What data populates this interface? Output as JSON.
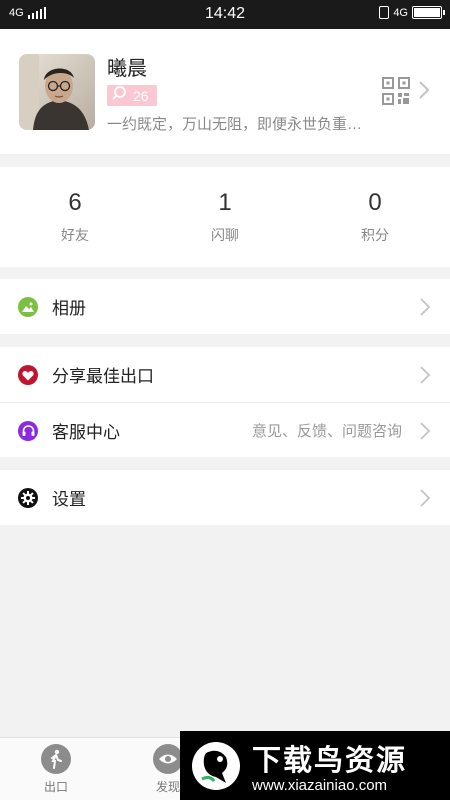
{
  "status_bar": {
    "network_left": "4G",
    "time": "14:42",
    "network_right": "4G",
    "battery_level": 1.0
  },
  "profile": {
    "name": "曦晨",
    "badge_count": "26",
    "signature": "一约既定，万山无阻，即便永世负重…",
    "badge_color": "#f9c8d2"
  },
  "stats": [
    {
      "value": "6",
      "label": "好友"
    },
    {
      "value": "1",
      "label": "闪聊"
    },
    {
      "value": "0",
      "label": "积分"
    }
  ],
  "menu": {
    "album": {
      "label": "相册",
      "icon": "image-icon",
      "color": "#7bc043"
    },
    "share_exit": {
      "label": "分享最佳出口",
      "icon": "heart-icon",
      "color": "#c0152f"
    },
    "support": {
      "label": "客服中心",
      "hint": "意见、反馈、问题咨询",
      "icon": "headset-icon",
      "color": "#8a2be2"
    },
    "settings": {
      "label": "设置",
      "icon": "gear-icon",
      "color": "#111111"
    }
  },
  "tabbar": {
    "exit": {
      "label": "出口",
      "icon": "walking-person-icon"
    },
    "discover": {
      "label": "发现",
      "icon": "eye-icon"
    }
  },
  "watermark": {
    "title": "下载鸟资源",
    "url": "www.xiazainiao.com"
  }
}
